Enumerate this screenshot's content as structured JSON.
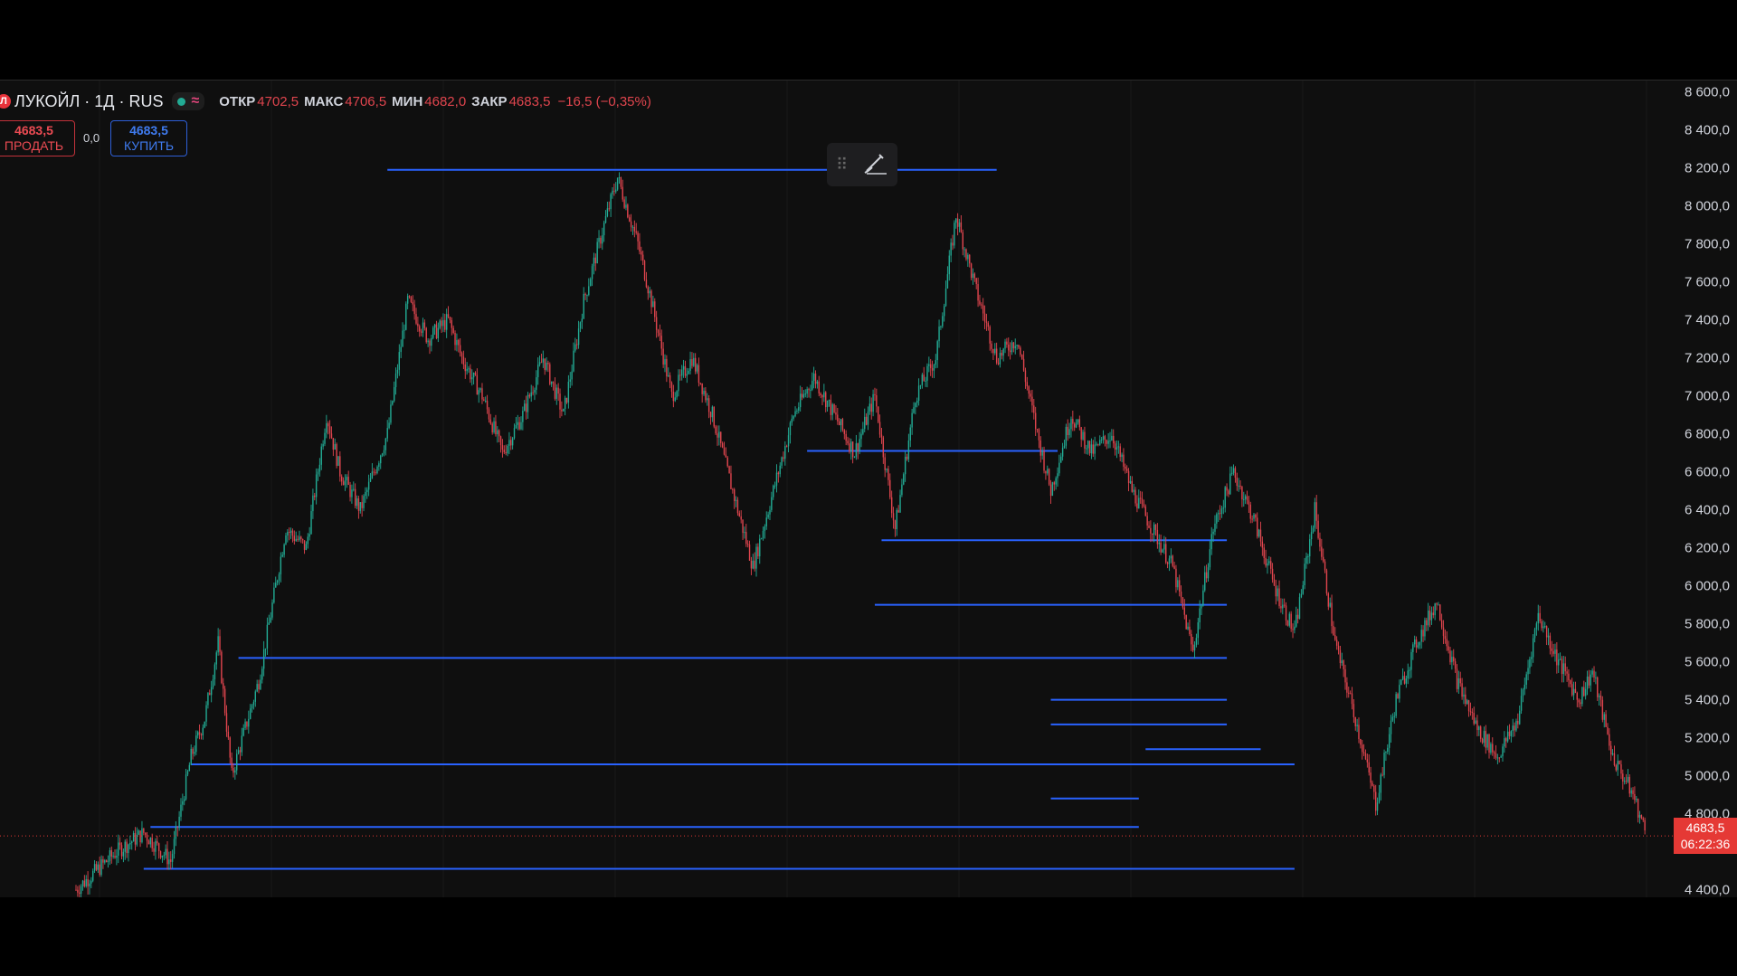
{
  "instrument": {
    "logo": "Л",
    "symbol": "ЛУКОЙЛ · 1Д · RUS",
    "wave_glyph": "≈",
    "open_label": "ОТКР",
    "open": "4702,5",
    "high_label": "МАКС",
    "high": "4706,5",
    "low_label": "МИН",
    "low": "4682,0",
    "close_label": "ЗАКР",
    "close": "4683,5",
    "change": "−16,5 (−0,35%)"
  },
  "trade": {
    "sell_price": "4683,5",
    "sell_label": "ПРОДАТЬ",
    "spread": "0,0",
    "buy_price": "4683,5",
    "buy_label": "КУПИТЬ"
  },
  "price_axis": {
    "labels": [
      "8 600,0",
      "8 400,0",
      "8 200,0",
      "8 000,0",
      "7 800,0",
      "7 600,0",
      "7 400,0",
      "7 200,0",
      "7 000,0",
      "6 800,0",
      "6 600,0",
      "6 400,0",
      "6 200,0",
      "6 000,0",
      "5 800,0",
      "5 600,0",
      "5 400,0",
      "5 200,0",
      "5 000,0",
      "4 800,0",
      "4 400,0"
    ],
    "current_price": "4683,5",
    "countdown": "06:22:36"
  },
  "colors": {
    "background": "#0f0f0f",
    "up": "#22ab94",
    "down": "#e0454e",
    "level_lines": "#2962ff",
    "current_price": "#e53935"
  },
  "toolbox": {
    "icons": [
      "drag-handle-icon",
      "brush-icon"
    ]
  },
  "chart_data": {
    "type": "candlestick",
    "timeframe": "1Д",
    "ylim": [
      4360,
      8660
    ],
    "price_path": [
      [
        0,
        4400
      ],
      [
        6,
        4600
      ],
      [
        10,
        4700
      ],
      [
        14,
        4550
      ],
      [
        17,
        5100
      ],
      [
        19,
        5300
      ],
      [
        21,
        5700
      ],
      [
        23,
        5000
      ],
      [
        27,
        5500
      ],
      [
        31,
        6300
      ],
      [
        34,
        6200
      ],
      [
        37,
        6900
      ],
      [
        39,
        6600
      ],
      [
        42,
        6400
      ],
      [
        46,
        6800
      ],
      [
        49,
        7500
      ],
      [
        52,
        7300
      ],
      [
        55,
        7400
      ],
      [
        57,
        7200
      ],
      [
        60,
        7000
      ],
      [
        63,
        6700
      ],
      [
        66,
        6900
      ],
      [
        69,
        7200
      ],
      [
        72,
        6900
      ],
      [
        75,
        7500
      ],
      [
        78,
        7900
      ],
      [
        80,
        8150
      ],
      [
        83,
        7800
      ],
      [
        85,
        7500
      ],
      [
        88,
        7000
      ],
      [
        91,
        7200
      ],
      [
        94,
        6900
      ],
      [
        97,
        6500
      ],
      [
        100,
        6100
      ],
      [
        103,
        6500
      ],
      [
        106,
        6900
      ],
      [
        109,
        7100
      ],
      [
        112,
        6900
      ],
      [
        115,
        6700
      ],
      [
        118,
        7000
      ],
      [
        121,
        6300
      ],
      [
        124,
        7000
      ],
      [
        127,
        7200
      ],
      [
        130,
        7950
      ],
      [
        133,
        7550
      ],
      [
        136,
        7200
      ],
      [
        139,
        7300
      ],
      [
        142,
        6800
      ],
      [
        144,
        6500
      ],
      [
        147,
        6900
      ],
      [
        150,
        6700
      ],
      [
        153,
        6800
      ],
      [
        156,
        6500
      ],
      [
        159,
        6300
      ],
      [
        162,
        6100
      ],
      [
        165,
        5650
      ],
      [
        168,
        6300
      ],
      [
        171,
        6600
      ],
      [
        174,
        6350
      ],
      [
        177,
        6000
      ],
      [
        180,
        5750
      ],
      [
        183,
        6400
      ],
      [
        186,
        5700
      ],
      [
        189,
        5300
      ],
      [
        192,
        4850
      ],
      [
        195,
        5400
      ],
      [
        198,
        5700
      ],
      [
        201,
        5920
      ],
      [
        204,
        5500
      ],
      [
        207,
        5250
      ],
      [
        210,
        5100
      ],
      [
        213,
        5300
      ],
      [
        216,
        5850
      ],
      [
        219,
        5600
      ],
      [
        222,
        5400
      ],
      [
        224,
        5550
      ],
      [
        227,
        5100
      ],
      [
        230,
        4900
      ],
      [
        232,
        4683
      ]
    ],
    "horizontal_levels": [
      {
        "price": 8190,
        "from_bar": 46,
        "to_bar": 136
      },
      {
        "price": 6710,
        "from_bar": 108,
        "to_bar": 145
      },
      {
        "price": 6240,
        "from_bar": 119,
        "to_bar": 170
      },
      {
        "price": 5900,
        "from_bar": 118,
        "to_bar": 170
      },
      {
        "price": 5620,
        "from_bar": 24,
        "to_bar": 170
      },
      {
        "price": 5400,
        "from_bar": 144,
        "to_bar": 170
      },
      {
        "price": 5270,
        "from_bar": 144,
        "to_bar": 170
      },
      {
        "price": 5140,
        "from_bar": 158,
        "to_bar": 175
      },
      {
        "price": 5060,
        "from_bar": 17,
        "to_bar": 180
      },
      {
        "price": 4880,
        "from_bar": 144,
        "to_bar": 157
      },
      {
        "price": 4730,
        "from_bar": 11,
        "to_bar": 157
      },
      {
        "price": 4510,
        "from_bar": 10,
        "to_bar": 180
      }
    ]
  }
}
